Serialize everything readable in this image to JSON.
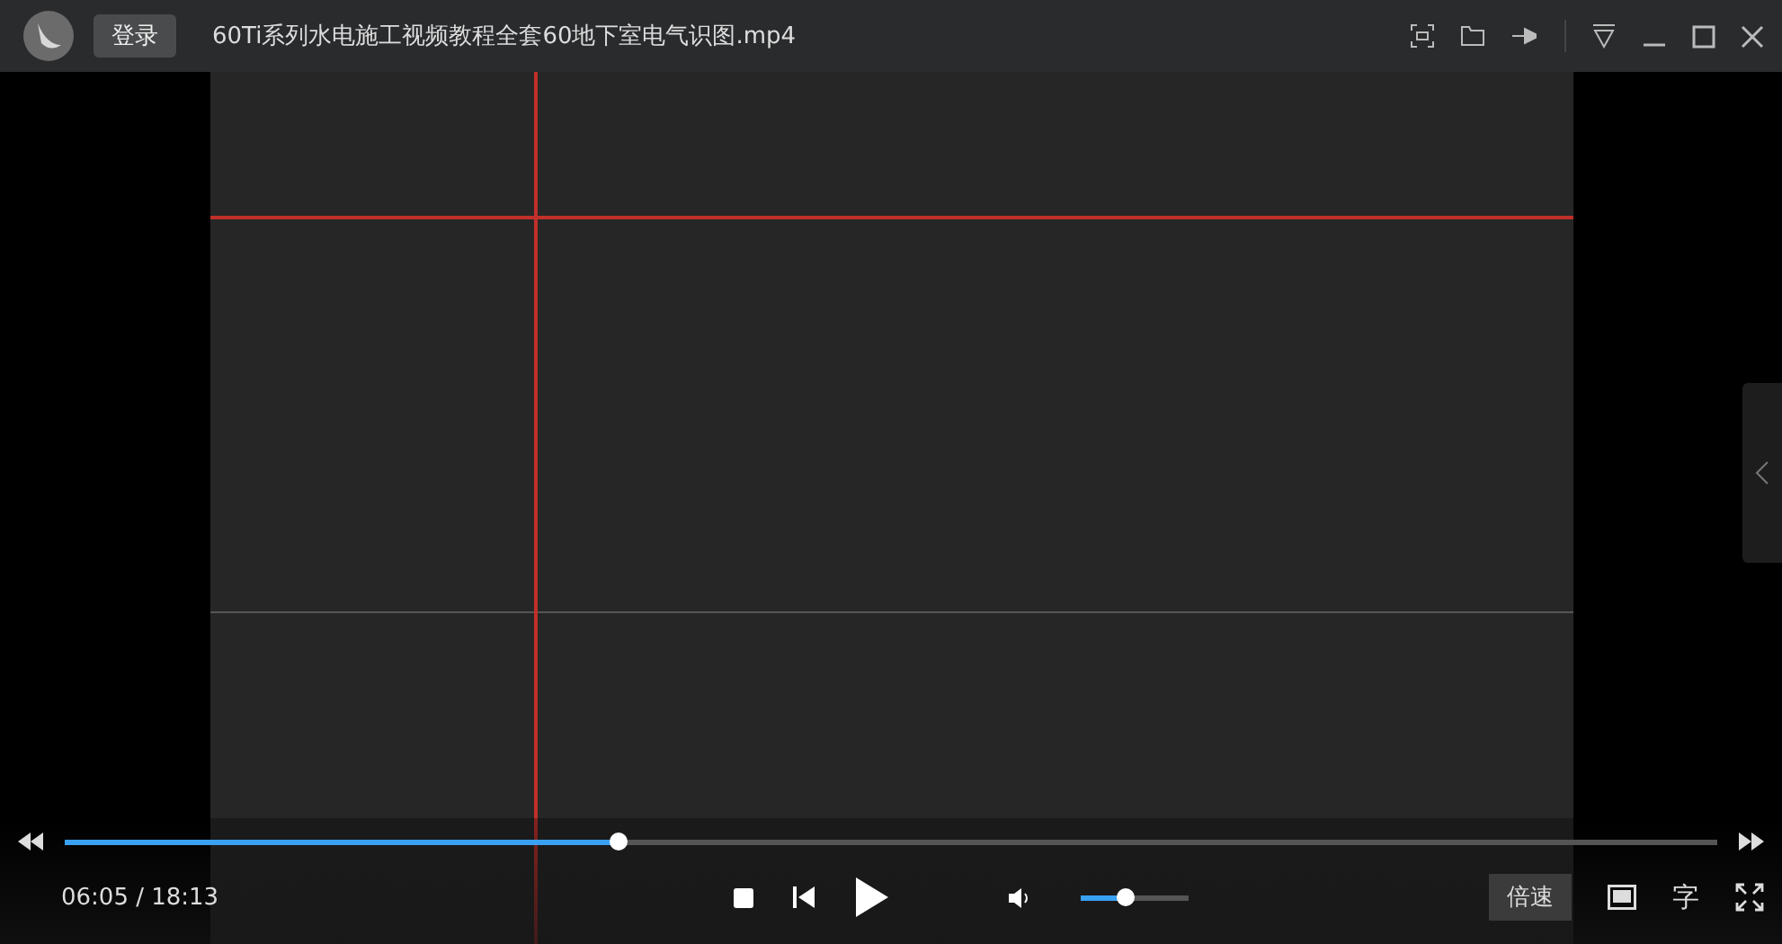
{
  "titlebar": {
    "login_button": "登录",
    "title": "60Ti系列水电施工视频教程全套60地下室电气识图.mp4"
  },
  "player": {
    "progress": {
      "level": 0.335
    },
    "time": "06:05 / 18:13",
    "volume": {
      "level": 0.42
    },
    "speed_button": "倍速",
    "subtitle_button": "字"
  }
}
